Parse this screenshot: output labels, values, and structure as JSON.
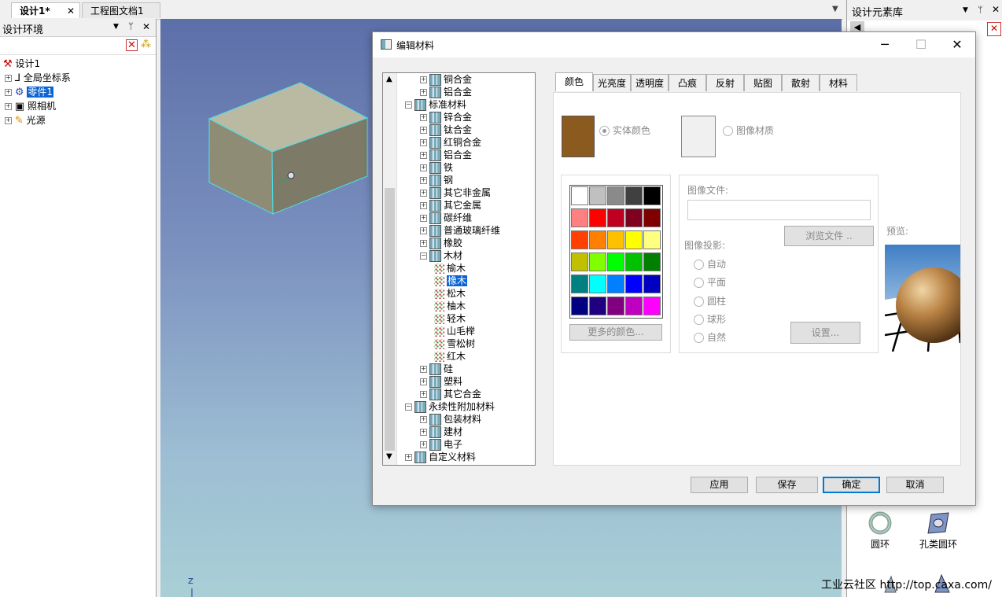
{
  "doc_tabs": [
    {
      "label": "设计1*",
      "active": true
    },
    {
      "label": "工程图文档1",
      "active": false
    }
  ],
  "left_panel": {
    "title": "设计环境",
    "tree": [
      {
        "label": "设计1",
        "icon": "design-icon"
      },
      {
        "label": "全局坐标系",
        "icon": "axis-icon"
      },
      {
        "label": "零件1",
        "icon": "part-icon",
        "selected": true
      },
      {
        "label": "照相机",
        "icon": "camera-icon"
      },
      {
        "label": "光源",
        "icon": "light-icon"
      }
    ]
  },
  "right_panel": {
    "title": "设计元素库",
    "items": [
      {
        "label": "圆环",
        "icon": "torus-icon"
      },
      {
        "label": "孔类圆环",
        "icon": "hole-torus-icon"
      }
    ]
  },
  "viewport": {
    "axis_label": "Z",
    "box_colors": {
      "top": "#bab9a2",
      "front": "#8f8c76",
      "side": "#7d7a67",
      "edge": "#4fe0e8"
    }
  },
  "watermark": "工业云社区 http://top.caxa.com/",
  "dialog": {
    "title": "编辑材料",
    "tree": [
      {
        "label": "铜合金",
        "level": 1,
        "kind": "mat"
      },
      {
        "label": "铝合金",
        "level": 1,
        "kind": "mat"
      },
      {
        "label": "标准材料",
        "level": 0,
        "kind": "mat",
        "expanded": true
      },
      {
        "label": "锌合金",
        "level": 1,
        "kind": "mat"
      },
      {
        "label": "钛合金",
        "level": 1,
        "kind": "mat"
      },
      {
        "label": "红铜合金",
        "level": 1,
        "kind": "mat"
      },
      {
        "label": "铝合金",
        "level": 1,
        "kind": "mat"
      },
      {
        "label": "铁",
        "level": 1,
        "kind": "mat"
      },
      {
        "label": "钢",
        "level": 1,
        "kind": "mat"
      },
      {
        "label": "其它非金属",
        "level": 1,
        "kind": "mat"
      },
      {
        "label": "其它金属",
        "level": 1,
        "kind": "mat"
      },
      {
        "label": "碳纤维",
        "level": 1,
        "kind": "mat"
      },
      {
        "label": "普通玻璃纤维",
        "level": 1,
        "kind": "mat"
      },
      {
        "label": "橡胶",
        "level": 1,
        "kind": "mat"
      },
      {
        "label": "木材",
        "level": 1,
        "kind": "mat",
        "expanded": true
      },
      {
        "label": "榆木",
        "level": 2,
        "kind": "leaf"
      },
      {
        "label": "橡木",
        "level": 2,
        "kind": "leaf",
        "selected": true
      },
      {
        "label": "松木",
        "level": 2,
        "kind": "leaf"
      },
      {
        "label": "柚木",
        "level": 2,
        "kind": "leaf"
      },
      {
        "label": "轻木",
        "level": 2,
        "kind": "leaf"
      },
      {
        "label": "山毛榉",
        "level": 2,
        "kind": "leaf"
      },
      {
        "label": "雪松树",
        "level": 2,
        "kind": "leaf"
      },
      {
        "label": "红木",
        "level": 2,
        "kind": "leaf"
      },
      {
        "label": "硅",
        "level": 1,
        "kind": "mat"
      },
      {
        "label": "塑料",
        "level": 1,
        "kind": "mat"
      },
      {
        "label": "其它合金",
        "level": 1,
        "kind": "mat"
      },
      {
        "label": "永续性附加材料",
        "level": 0,
        "kind": "mat",
        "expanded": true
      },
      {
        "label": "包装材料",
        "level": 1,
        "kind": "mat"
      },
      {
        "label": "建材",
        "level": 1,
        "kind": "mat"
      },
      {
        "label": "电子",
        "level": 1,
        "kind": "mat"
      },
      {
        "label": "自定义材料",
        "level": 0,
        "kind": "mat"
      }
    ],
    "tabs": [
      "颜色",
      "光亮度",
      "透明度",
      "凸痕",
      "反射",
      "贴图",
      "散射",
      "材料"
    ],
    "active_tab": "颜色",
    "solid_color_label": "实体颜色",
    "image_material_label": "图像材质",
    "current_color": "#8b5a1f",
    "palette": [
      [
        "#ffffff",
        "#c0c0c0",
        "#8a8a8a",
        "#404040",
        "#000000"
      ],
      [
        "#ff8080",
        "#ff0000",
        "#c00020",
        "#800020",
        "#800000"
      ],
      [
        "#ff4000",
        "#ff8000",
        "#ffc000",
        "#ffff00",
        "#ffff80"
      ],
      [
        "#c0c000",
        "#80ff00",
        "#00ff00",
        "#00c000",
        "#008000"
      ],
      [
        "#008080",
        "#00ffff",
        "#0080ff",
        "#0000ff",
        "#0000c0"
      ],
      [
        "#000080",
        "#200080",
        "#800080",
        "#c000c0",
        "#ff00ff"
      ]
    ],
    "more_colors_label": "更多的颜色...",
    "image_file_label": "图像文件:",
    "image_file_value": "",
    "browse_label": "浏览文件 ..",
    "projection_label": "图像投影:",
    "projections": [
      "自动",
      "平面",
      "圆柱",
      "球形",
      "自然"
    ],
    "settings_label": "设置...",
    "preview_label": "预览:",
    "buttons": {
      "apply": "应用",
      "save": "保存",
      "ok": "确定",
      "cancel": "取消"
    }
  }
}
